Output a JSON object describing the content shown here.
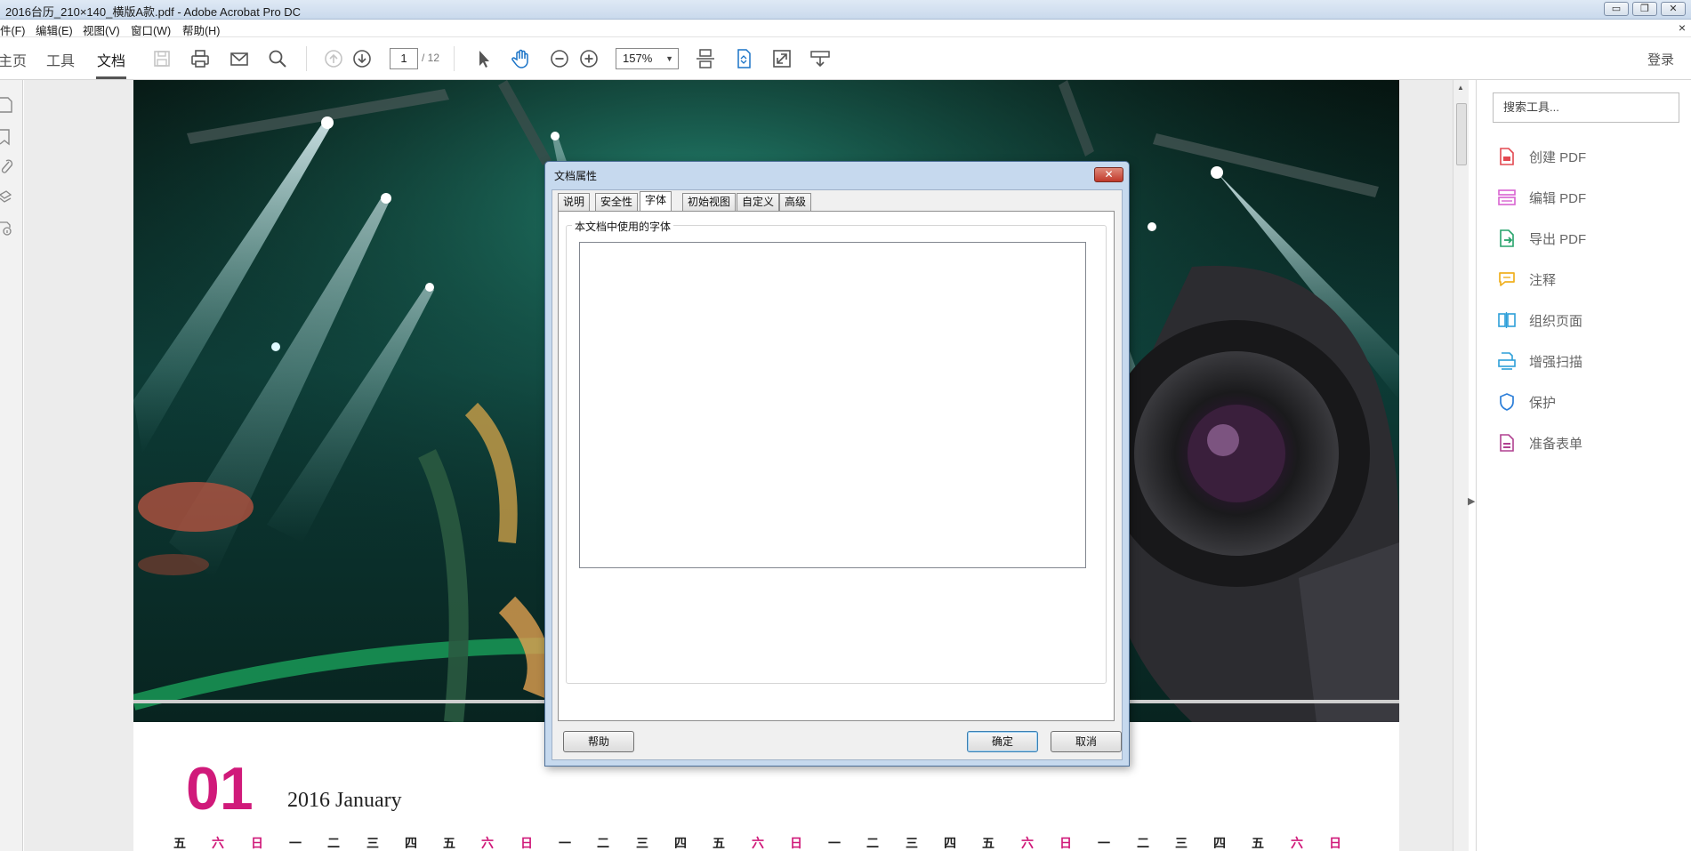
{
  "window": {
    "title": "2016台历_210×140_横版A款.pdf - Adobe Acrobat Pro DC",
    "min_glyph": "▭",
    "max_glyph": "❐",
    "close_glyph": "✕"
  },
  "menu": {
    "items": [
      "件(F)",
      "编辑(E)",
      "视图(V)",
      "窗口(W)",
      "帮助(H)"
    ],
    "close_glyph": "×"
  },
  "toolbar": {
    "nav_tabs": [
      "主页",
      "工具",
      "文档"
    ],
    "active_tab": "文档",
    "page_current": "1",
    "page_total": "/ 12",
    "zoom": "157%",
    "zoom_arrow": "▼",
    "login": "登录",
    "icons": [
      "save-icon",
      "print-icon",
      "email-icon",
      "search-icon",
      "page-up-icon",
      "page-down-icon",
      "select-cursor-icon",
      "hand-tool-icon",
      "zoom-out-icon",
      "zoom-in-icon",
      "scroll-mode-icon",
      "fit-page-icon",
      "full-screen-icon",
      "read-mode-icon"
    ]
  },
  "left_pane": {
    "icons": [
      "page-thumbnails-icon",
      "bookmarks-icon",
      "attachments-icon",
      "layers-icon",
      "security-icon"
    ],
    "collapse_glyph": "◀"
  },
  "document": {
    "month_number": "01",
    "month_text": "2016 January",
    "weekdays": [
      "五",
      "六",
      "日",
      "一",
      "二",
      "三",
      "四",
      "五",
      "六",
      "日",
      "一",
      "二",
      "三",
      "四",
      "五",
      "六",
      "日",
      "一",
      "二",
      "三",
      "四",
      "五",
      "六",
      "日",
      "一",
      "二",
      "三",
      "四",
      "五",
      "六",
      "日"
    ],
    "weekend_color": "#d01a7a"
  },
  "scrollbar": {
    "up_glyph": "▲",
    "right_collapse_glyph": "▶"
  },
  "tools_pane": {
    "search_placeholder": "搜索工具...",
    "items": [
      {
        "label": "创建 PDF",
        "icon": "create-pdf-icon",
        "color": "#e34850"
      },
      {
        "label": "编辑 PDF",
        "icon": "edit-pdf-icon",
        "color": "#d963d1"
      },
      {
        "label": "导出 PDF",
        "icon": "export-pdf-icon",
        "color": "#26a36b"
      },
      {
        "label": "注释",
        "icon": "comment-icon",
        "color": "#f0b020"
      },
      {
        "label": "组织页面",
        "icon": "organize-pages-icon",
        "color": "#2d9fd9"
      },
      {
        "label": "增强扫描",
        "icon": "enhance-scan-icon",
        "color": "#2d9fd9"
      },
      {
        "label": "保护",
        "icon": "protect-icon",
        "color": "#2d7fd9"
      },
      {
        "label": "准备表单",
        "icon": "prepare-form-icon",
        "color": "#b04090"
      }
    ]
  },
  "dialog": {
    "title": "文档属性",
    "close_glyph": "✕",
    "tabs": [
      "说明",
      "安全性",
      "字体",
      "初始视图",
      "自定义",
      "高级"
    ],
    "active_tab": "字体",
    "group_label": "本文档中使用的字体",
    "buttons": {
      "help": "帮助",
      "ok": "确定",
      "cancel": "取消"
    }
  }
}
